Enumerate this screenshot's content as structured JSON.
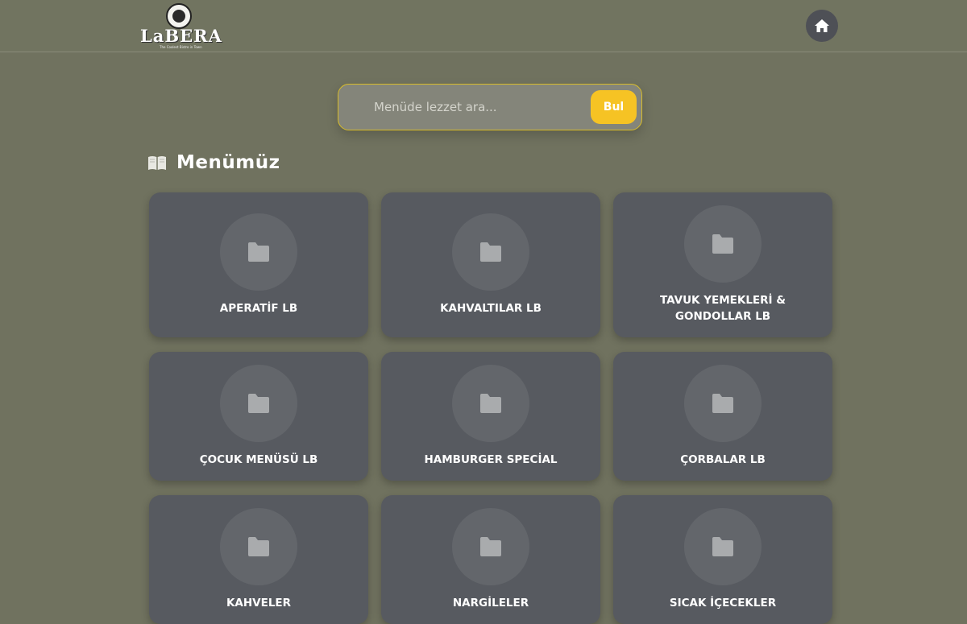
{
  "header": {
    "logo_text": "LaBERA",
    "logo_tagline": "The Coolest Bistro in Town",
    "home_icon": "home-icon"
  },
  "search": {
    "placeholder": "Menüde lezzet ara...",
    "button_label": "Bul",
    "accent_color": "#f6c324"
  },
  "section": {
    "icon": "book-icon",
    "title": "Menümüz"
  },
  "categories": [
    {
      "label": "APERATİF LB",
      "icon": "folder-icon"
    },
    {
      "label": "KAHVALTILAR LB",
      "icon": "folder-icon"
    },
    {
      "label": "TAVUK YEMEKLERİ & GONDOLLAR LB",
      "icon": "folder-icon"
    },
    {
      "label": "ÇOCUK MENÜSÜ LB",
      "icon": "folder-icon"
    },
    {
      "label": "HAMBURGER SPECİAL",
      "icon": "folder-icon"
    },
    {
      "label": "ÇORBALAR LB",
      "icon": "folder-icon"
    },
    {
      "label": "KAHVELER",
      "icon": "folder-icon"
    },
    {
      "label": "NARGİLELER",
      "icon": "folder-icon"
    },
    {
      "label": "SICAK İÇECEKLER",
      "icon": "folder-icon"
    }
  ]
}
